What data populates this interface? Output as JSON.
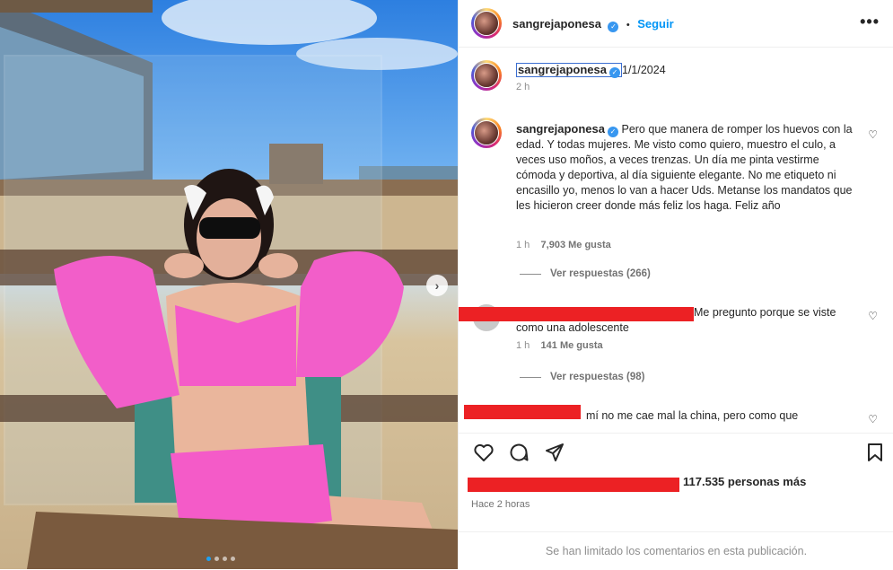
{
  "post": {
    "username": "sangrejaponesa",
    "follow_label": "Seguir",
    "more_label": "•••",
    "verified_icon": "verified-badge-icon"
  },
  "caption_date": {
    "username": "sangrejaponesa",
    "date": "1/1/2024",
    "time": "2 h"
  },
  "caption": {
    "username": "sangrejaponesa",
    "text": "Pero que manera de romper los huevos con la edad. Y todas mujeres. Me visto como quiero, muestro el culo, a veces uso moños, a veces trenzas. Un día me pinta vestirme cómoda y deportiva, al día siguiente elegante. No me etiqueto ni encasillo yo, menos lo van a hacer Uds. Metanse los mandatos que les hicieron creer donde más feliz los haga. Feliz año",
    "time": "1 h",
    "likes": "7,903 Me gusta",
    "replies": "Ver respuestas (266)"
  },
  "comment1": {
    "text": "Me pregunto porque se viste como una adolescente",
    "time": "1 h",
    "likes": "141 Me gusta",
    "replies": "Ver respuestas (98)"
  },
  "comment2": {
    "text": "mí no me cae mal la china, pero como que"
  },
  "likes_summary": "117.535 personas más",
  "timestamp": "Hace 2 horas",
  "comments_limited": "Se han limitado los comentarios en esta publicación.",
  "colors": {
    "accent": "#0095f6",
    "redaction": "#ec2124",
    "verified": "#3897f0"
  }
}
